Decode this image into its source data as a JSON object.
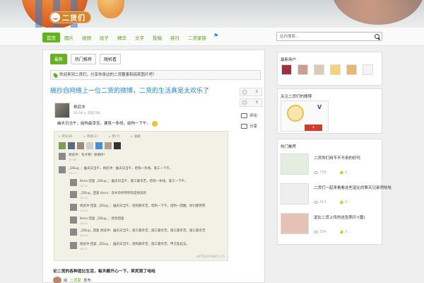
{
  "logo": {
    "text": "二货们"
  },
  "nav": {
    "items": [
      "首页",
      "图片",
      "视频",
      "段子",
      "精华",
      "文字",
      "投稿",
      "排行",
      "二货家族",
      "手机版"
    ]
  },
  "search": {
    "placeholder": "站内搜索..."
  },
  "tabs": [
    "最新",
    "热门推荐",
    "随机看"
  ],
  "notice": "欢迎来到二货们，分享你身边的二货趣事和搞笑图片吧！",
  "post": {
    "title": "摘抄自网络上一位二货的微博，二货的生活真是太欢乐了",
    "author": "杨武冲",
    "meta": "16:58   ◎ 浏览(58)",
    "text": "幽夫日当午，结构最幸苦。建筑一条线，结构一下午。",
    "votes": {
      "up": "0",
      "down": "0"
    },
    "comment_label": "评论",
    "share_label": "分享",
    "weibo": {
      "bar": [
        "评论(8)",
        "转发(2)",
        "赞(7)",
        "收藏"
      ],
      "rows": [
        {
          "text": "杨武冲：有才啊！谢谢你!",
          "meta": "17:09"
        },
        {
          "text": "_DDup_：幽夫日当午，杨武冲：幽夫日当午，结构一条线，施工一下午。",
          "meta": "18:11"
        },
        {
          "text": "Keno 回复 _DDup_：幽夫日当午，施工最幸苦，结构一条线，施工一下午。",
          "meta": "18:12"
        },
        {
          "text": "_DDup_ 回复 Keno：现木有杯啰啰的是想说的",
          "meta": "18:13"
        },
        {
          "text": "杨武冲 回复 _DDup_：幽夫日当午，结构最幸苦，结构一下午，结构一回魔，你们都晃晃",
          "meta": "18:14"
        },
        {
          "text": "Keno 回复 _DDup_：结构回复",
          "meta": "18:15"
        },
        {
          "text": "_DDup_ 回复 杨武冲：幽夫日当午，施工最幸苦，施工最幸苦，施工最幸苦，施工最幸苦",
          "meta": "18:16"
        },
        {
          "text": "杨武冲 回复 _DDup_：幽夫日当午，结构最幸苦，施工最幸苦，甲方乱起法。",
          "meta": "18:17"
        }
      ],
      "watermark": "erhuomen.cn"
    }
  },
  "post2": {
    "title": "论二货的各种逗比生活，每天都开心一下，笑死我了哈哈",
    "author_prefix": "由",
    "author": "二货家",
    "author_suffix": "发布"
  },
  "panels": {
    "users_title": "最新用户",
    "weibo_title": "关注二货们的微博",
    "follow_label": "+",
    "hot_title": "热门推荐",
    "hot": [
      {
        "title": "二货你们用不不不用的好吗",
        "views": "739",
        "likes": "0"
      },
      {
        "title": "二货们一起来看看这些逗比的聊天记录吧哈哈",
        "views": "413",
        "likes": "0"
      },
      {
        "title": "逗比二货上传的这张照片!(雷)",
        "views": "334",
        "likes": "9"
      }
    ]
  },
  "colors": {
    "brand_green": "#66b022",
    "link_blue": "#2b86c5",
    "follow_red": "#d43a2a"
  }
}
